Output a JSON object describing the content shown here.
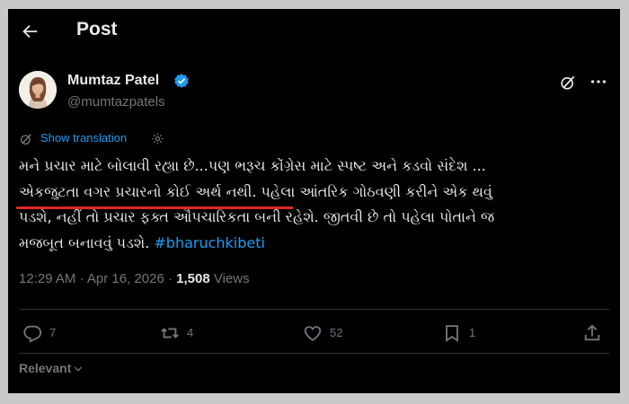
{
  "header": {
    "title": "Post"
  },
  "author": {
    "name": "Mumtaz Patel",
    "handle": "@mumtazpatels"
  },
  "translation": {
    "label": "Show translation"
  },
  "post": {
    "lines": [
      "મને પ્રચાર માટે બોલાવી રહ્યા છે...પણ ભરૂચ કોંગ્રેસ માટે સ્પષ્ટ અને કડવો સંદેશ ...",
      "એકજુટતા વગર પ્રચારનો કોઈ અર્થ નથી. પહેલા આંતરિક ગોઠવણી કરીને એક થવું",
      "પડશે, નહીં તો પ્રચાર ફક્ત ઔપચારિકતા બની રહેશે. જીતવી છે તો પહેલા પોતાને જ",
      "મજબૂત બનાવવું પડશે."
    ],
    "hashtag": "#bharuchkibeti"
  },
  "meta": {
    "time": "12:29 AM",
    "separator": "·",
    "date": "Apr 16, 2026",
    "views_count": "1,508",
    "views_label": "Views"
  },
  "actions": {
    "replies": "7",
    "reposts": "4",
    "likes": "52",
    "bookmarks": "1"
  },
  "sort": {
    "label": "Relevant"
  },
  "colors": {
    "background": "#000000",
    "text": "#e7e9ea",
    "muted": "#71767b",
    "accent": "#1d9bf0",
    "highlight_underline": "#e0262a"
  },
  "icons": [
    "back-arrow-icon",
    "verified-badge-icon",
    "grok-icon",
    "more-icon",
    "translate-icon",
    "settings-icon",
    "reply-icon",
    "repost-icon",
    "like-icon",
    "bookmark-icon",
    "share-icon",
    "chevron-down-icon"
  ]
}
